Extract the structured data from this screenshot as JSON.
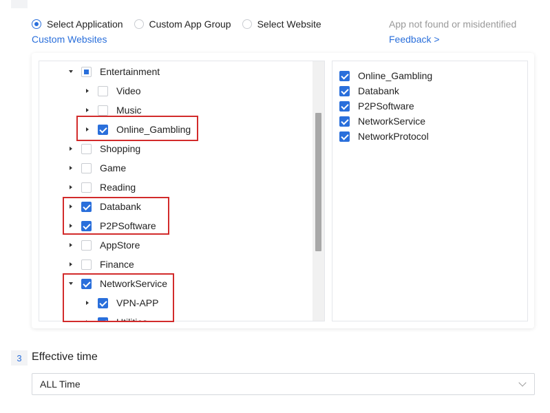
{
  "filter_type": {
    "options": [
      {
        "label": "Select Application",
        "selected": true
      },
      {
        "label": "Custom App Group",
        "selected": false
      },
      {
        "label": "Select Website",
        "selected": false
      }
    ],
    "custom_link": "Custom Websites"
  },
  "hint": {
    "text": "App not found or misidentified",
    "feedback_link": "Feedback >"
  },
  "tree": {
    "nodes": [
      {
        "label": "Entertainment",
        "level": 0,
        "expanded": true,
        "state": "partial"
      },
      {
        "label": "Video",
        "level": 1,
        "expanded": false,
        "state": "unchecked"
      },
      {
        "label": "Music",
        "level": 1,
        "expanded": false,
        "state": "unchecked"
      },
      {
        "label": "Online_Gambling",
        "level": 1,
        "expanded": false,
        "state": "checked"
      },
      {
        "label": "Shopping",
        "level": 0,
        "expanded": false,
        "state": "unchecked"
      },
      {
        "label": "Game",
        "level": 0,
        "expanded": false,
        "state": "unchecked"
      },
      {
        "label": "Reading",
        "level": 0,
        "expanded": false,
        "state": "unchecked"
      },
      {
        "label": "Databank",
        "level": 0,
        "expanded": false,
        "state": "checked"
      },
      {
        "label": "P2PSoftware",
        "level": 0,
        "expanded": false,
        "state": "checked"
      },
      {
        "label": "AppStore",
        "level": 0,
        "expanded": false,
        "state": "unchecked"
      },
      {
        "label": "Finance",
        "level": 0,
        "expanded": false,
        "state": "unchecked"
      },
      {
        "label": "NetworkService",
        "level": 0,
        "expanded": true,
        "state": "checked"
      },
      {
        "label": "VPN-APP",
        "level": 1,
        "expanded": false,
        "state": "checked"
      },
      {
        "label": "Utilities",
        "level": 1,
        "expanded": false,
        "state": "checked"
      }
    ]
  },
  "selected_items": [
    "Online_Gambling",
    "Databank",
    "P2PSoftware",
    "NetworkService",
    "NetworkProtocol"
  ],
  "effective_time": {
    "step_number": "3",
    "title": "Effective time",
    "value": "ALL Time"
  },
  "colors": {
    "accent": "#2a6fdb",
    "highlight": "#d22a2a",
    "muted": "#999999"
  }
}
